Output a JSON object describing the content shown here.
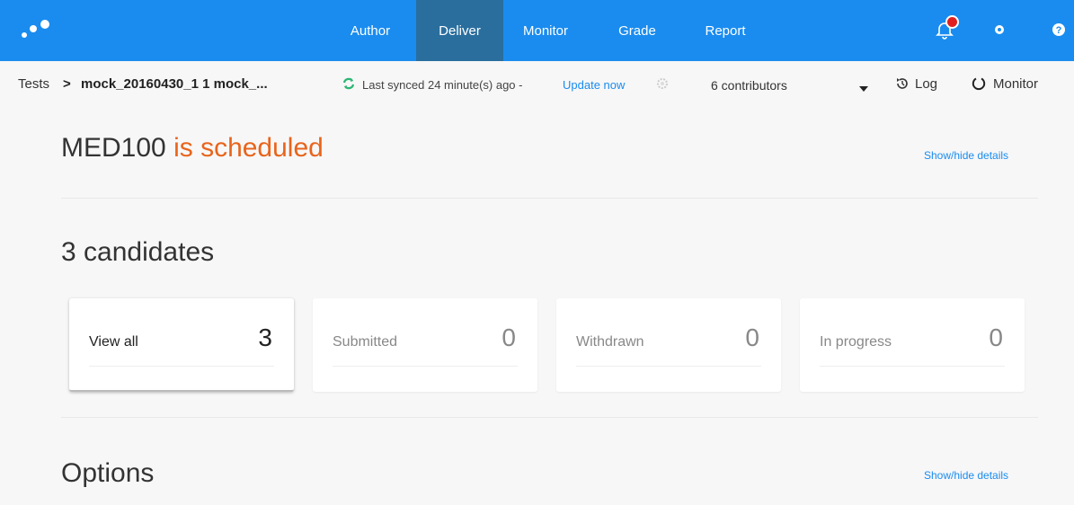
{
  "nav": {
    "items": [
      {
        "label": "Author"
      },
      {
        "label": "Deliver"
      },
      {
        "label": "Monitor"
      },
      {
        "label": "Grade"
      },
      {
        "label": "Report"
      }
    ],
    "active": "Deliver"
  },
  "breadcrumb": {
    "root": "Tests",
    "separator": ">",
    "current": "mock_20160430_1 1 mock_..."
  },
  "sync": {
    "text": "Last synced 24 minute(s) ago -",
    "update_label": "Update now"
  },
  "contributors": "6 contributors",
  "actions": {
    "log": "Log",
    "monitor": "Monitor"
  },
  "status": {
    "name": "MED100",
    "state": "is scheduled",
    "toggle": "Show/hide details"
  },
  "candidates": {
    "heading": "3 candidates",
    "cards": [
      {
        "label": "View all",
        "count": "3"
      },
      {
        "label": "Submitted",
        "count": "0"
      },
      {
        "label": "Withdrawn",
        "count": "0"
      },
      {
        "label": "In progress",
        "count": "0"
      }
    ]
  },
  "options": {
    "heading": "Options",
    "toggle": "Show/hide details"
  },
  "colors": {
    "nav_bg": "#1a8cef",
    "nav_active": "#2a6e9e",
    "status_orange": "#e8641c",
    "link_blue": "#1a8cef",
    "sync_green": "#2bb673",
    "notification_red": "#e02020"
  },
  "icons": [
    "logo-dots",
    "bell-icon",
    "gear-icon",
    "help-icon",
    "sync-icon",
    "settings-icon",
    "caret-down-icon",
    "history-icon",
    "monitor-circle-icon"
  ]
}
